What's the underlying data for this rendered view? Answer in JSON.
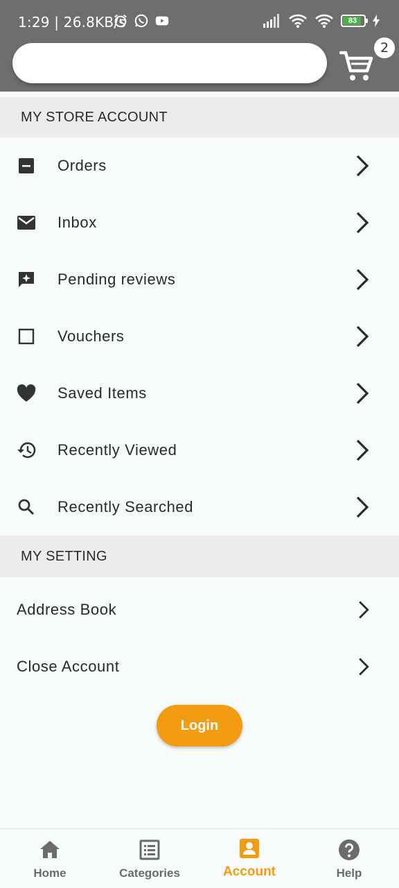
{
  "status_bar": {
    "time": "1:29 | 26.8KB/s",
    "battery": "83"
  },
  "header": {
    "search_placeholder": "",
    "cart_count": "2"
  },
  "sections": {
    "store_account": "MY STORE ACCOUNT",
    "setting": "MY SETTING"
  },
  "account_items": [
    {
      "label": "Orders",
      "icon": "orders-icon"
    },
    {
      "label": "Inbox",
      "icon": "mail-icon"
    },
    {
      "label": "Pending reviews",
      "icon": "review-icon"
    },
    {
      "label": "Vouchers",
      "icon": "voucher-icon"
    },
    {
      "label": "Saved Items",
      "icon": "heart-icon"
    },
    {
      "label": "Recently Viewed",
      "icon": "history-icon"
    },
    {
      "label": "Recently Searched",
      "icon": "search-icon"
    }
  ],
  "setting_items": [
    {
      "label": "Address Book"
    },
    {
      "label": "Close Account"
    }
  ],
  "login_label": "Login",
  "bottom_nav": [
    {
      "label": "Home",
      "icon": "home-icon"
    },
    {
      "label": "Categories",
      "icon": "categories-icon"
    },
    {
      "label": "Account",
      "icon": "account-icon",
      "active": true
    },
    {
      "label": "Help",
      "icon": "help-icon"
    }
  ],
  "colors": {
    "header_bg": "#6e6e6e",
    "accent": "#f39c12",
    "section_bg": "#ececec",
    "page_bg": "#f7fbfc",
    "battery": "#4caf50"
  }
}
